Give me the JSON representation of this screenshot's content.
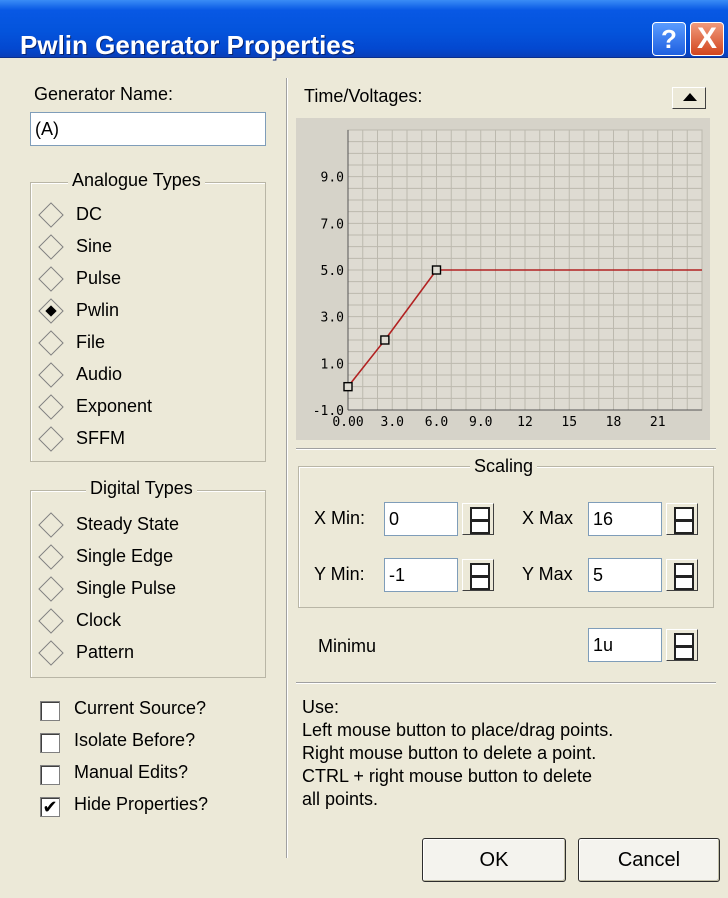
{
  "window": {
    "title": "Pwlin Generator Properties",
    "help_glyph": "?",
    "close_glyph": "X",
    "title_bar_color": "#0454dc"
  },
  "generator": {
    "name_label": "Generator Name:",
    "name_value": "(A)"
  },
  "analogue": {
    "title": "Analogue Types",
    "options": [
      "DC",
      "Sine",
      "Pulse",
      "Pwlin",
      "File",
      "Audio",
      "Exponent",
      "SFFM"
    ],
    "selected": "Pwlin"
  },
  "digital": {
    "title": "Digital Types",
    "options": [
      "Steady State",
      "Single Edge",
      "Single Pulse",
      "Clock",
      "Pattern"
    ]
  },
  "checkboxes": [
    {
      "label": "Current Source?",
      "checked": false
    },
    {
      "label": "Isolate Before?",
      "checked": false
    },
    {
      "label": "Manual Edits?",
      "checked": false
    },
    {
      "label": "Hide Properties?",
      "checked": true
    }
  ],
  "graph": {
    "label": "Time/Voltages:",
    "scroll_icon": "up-arrow-icon"
  },
  "chart_data": {
    "type": "line",
    "x_ticks": [
      "0.00",
      "3.0",
      "6.0",
      "9.0",
      "12",
      "15",
      "18",
      "21"
    ],
    "y_ticks": [
      "-1.0",
      "1.0",
      "3.0",
      "5.0",
      "7.0",
      "9.0"
    ],
    "xlim": [
      0,
      24
    ],
    "ylim": [
      -1,
      11
    ],
    "grid": true,
    "line_color": "#b22222",
    "points": [
      [
        0,
        0
      ],
      [
        2.5,
        2
      ],
      [
        6,
        5
      ]
    ],
    "line_end_x": 24
  },
  "scaling": {
    "title": "Scaling",
    "x_min_label": "X Min:",
    "x_min_value": "0",
    "x_max_label": "X Max",
    "x_max_value": "16",
    "y_min_label": "Y Min:",
    "y_min_value": "-1",
    "y_max_label": "Y Max",
    "y_max_value": "5"
  },
  "minimum": {
    "label": "Minimu",
    "value": "1u"
  },
  "usage": {
    "lines": [
      "Use:",
      "Left mouse button to place/drag points.",
      "Right mouse button to delete a point.",
      "CTRL + right mouse button to delete",
      "all points."
    ]
  },
  "buttons": {
    "ok": "OK",
    "cancel": "Cancel"
  }
}
